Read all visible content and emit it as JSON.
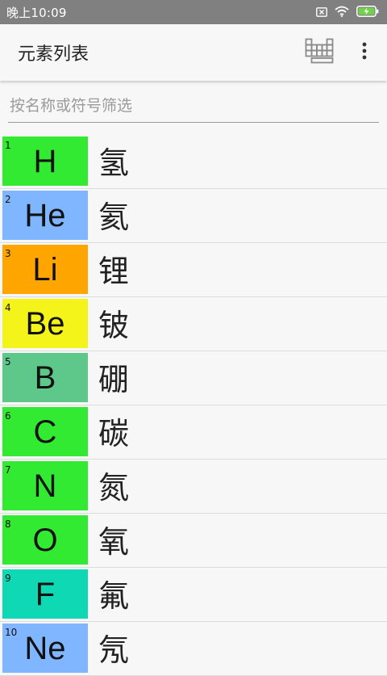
{
  "status": {
    "time": "晚上10:09"
  },
  "appbar": {
    "title": "元素列表",
    "table_icon": "periodic-table-icon",
    "menu_icon": "more-vert-icon"
  },
  "search": {
    "placeholder": "按名称或符号筛选",
    "value": ""
  },
  "elements": [
    {
      "number": "1",
      "symbol": "H",
      "name": "氢",
      "color": "#33ea33"
    },
    {
      "number": "2",
      "symbol": "He",
      "name": "氦",
      "color": "#80b6ff"
    },
    {
      "number": "3",
      "symbol": "Li",
      "name": "锂",
      "color": "#ffa500"
    },
    {
      "number": "4",
      "symbol": "Be",
      "name": "铍",
      "color": "#f4f41a"
    },
    {
      "number": "5",
      "symbol": "B",
      "name": "硼",
      "color": "#5ec88a"
    },
    {
      "number": "6",
      "symbol": "C",
      "name": "碳",
      "color": "#33ea33"
    },
    {
      "number": "7",
      "symbol": "N",
      "name": "氮",
      "color": "#33ea33"
    },
    {
      "number": "8",
      "symbol": "O",
      "name": "氧",
      "color": "#33ea33"
    },
    {
      "number": "9",
      "symbol": "F",
      "name": "氟",
      "color": "#0fd8b5"
    },
    {
      "number": "10",
      "symbol": "Ne",
      "name": "氖",
      "color": "#80b6ff"
    }
  ]
}
